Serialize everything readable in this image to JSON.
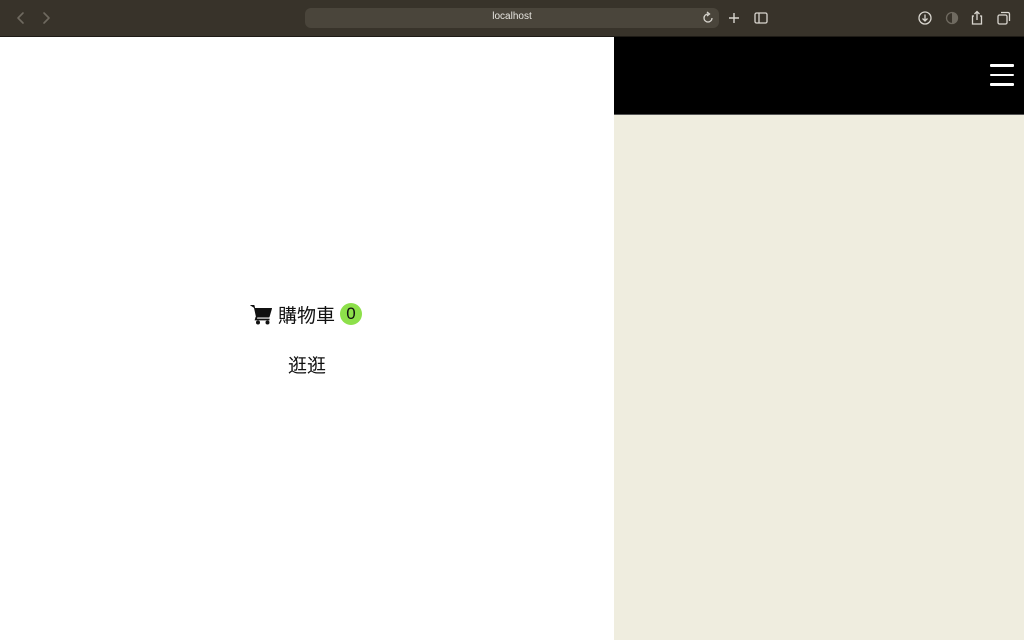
{
  "browser": {
    "url": "localhost",
    "chrome_color": "#38332a"
  },
  "cart": {
    "label": "購物車",
    "count": "0",
    "badge_color": "#8de04a",
    "icon": "shopping-cart-icon"
  },
  "browse": {
    "label": "逛逛"
  },
  "sidebar": {
    "header_color": "#000000",
    "background_color": "#efeddf",
    "menu_icon": "hamburger-menu-icon"
  }
}
